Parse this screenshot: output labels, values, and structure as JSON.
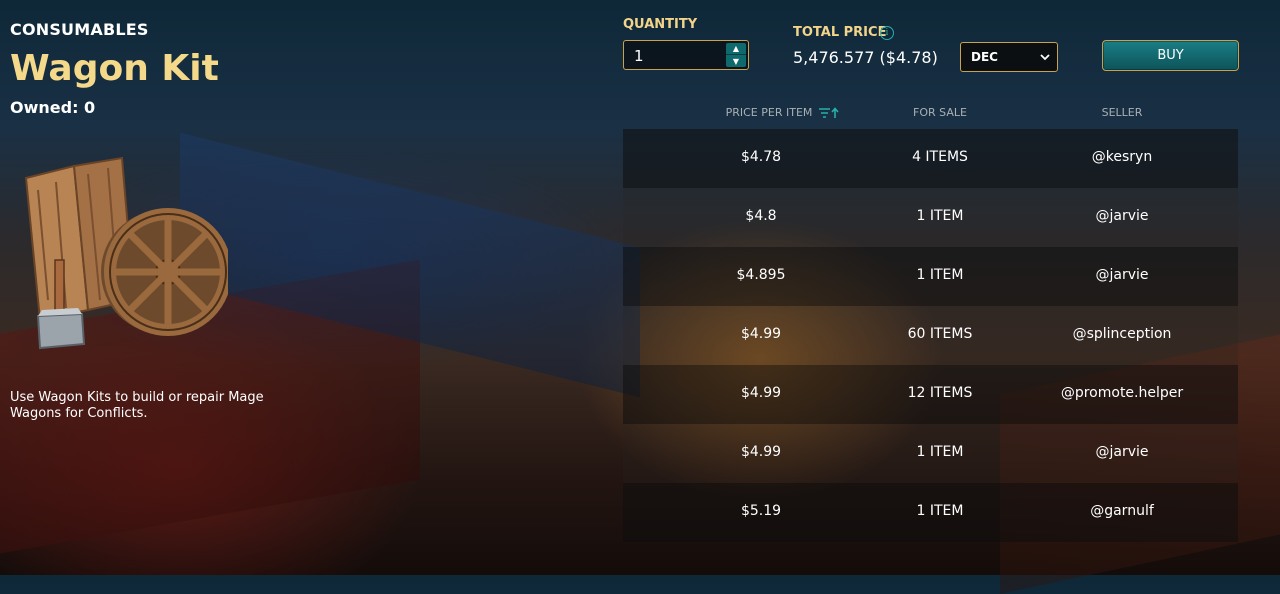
{
  "item": {
    "category": "CONSUMABLES",
    "name": "Wagon Kit",
    "owned": "Owned: 0",
    "description": "Use Wagon Kits to build or repair Mage Wagons for Conflicts."
  },
  "purchase": {
    "quantity_label": "QUANTITY",
    "quantity_value": "1",
    "total_price_label": "TOTAL PRICE",
    "total_price_value": "5,476.577 ($4.78)",
    "currency": "DEC",
    "buy_label": "BUY"
  },
  "listings": {
    "columns": [
      "PRICE PER ITEM",
      "FOR SALE",
      "SELLER"
    ],
    "rows": [
      {
        "price": "$4.78",
        "for_sale": "4 ITEMS",
        "seller": "@kesryn"
      },
      {
        "price": "$4.8",
        "for_sale": "1 ITEM",
        "seller": "@jarvie"
      },
      {
        "price": "$4.895",
        "for_sale": "1 ITEM",
        "seller": "@jarvie"
      },
      {
        "price": "$4.99",
        "for_sale": "60 ITEMS",
        "seller": "@splinception"
      },
      {
        "price": "$4.99",
        "for_sale": "12 ITEMS",
        "seller": "@promote.helper"
      },
      {
        "price": "$4.99",
        "for_sale": "1 ITEM",
        "seller": "@jarvie"
      },
      {
        "price": "$5.19",
        "for_sale": "1 ITEM",
        "seller": "@garnulf"
      }
    ]
  },
  "icons": {
    "info": "info-icon",
    "sort": "sort-icon",
    "dropdown": "chevron-down-icon",
    "stepper_up": "caret-up-icon",
    "stepper_down": "caret-down-icon"
  },
  "colors": {
    "title_gold": "#f5d98a",
    "label_gold": "#f2d48a",
    "border_gold": "#c9a24d",
    "teal": "#1a7e86"
  }
}
